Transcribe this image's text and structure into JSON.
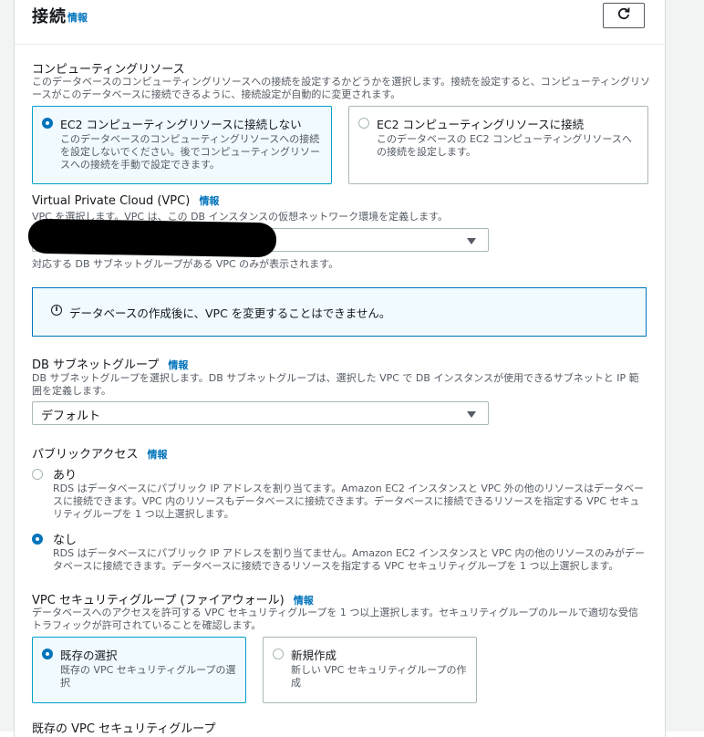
{
  "header": {
    "title": "接続",
    "info": "情報"
  },
  "compute": {
    "title": "コンピューティングリソース",
    "description": "このデータベースのコンピューティングリソースへの接続を設定するかどうかを選択します。接続を設定すると、コンピューティングリソースがこのデータベースに接続できるように、接続設定が自動的に変更されます。",
    "options": [
      {
        "label": "EC2 コンピューティングリソースに接続しない",
        "description": "このデータベースのコンピューティングリソースへの接続を設定しないでください。後でコンピューティングリソースへの接続を手動で設定できます。",
        "selected": true
      },
      {
        "label": "EC2 コンピューティングリソースに接続",
        "description": "このデータベースの EC2 コンピューティングリソースへの接続を設定します。",
        "selected": false
      }
    ]
  },
  "vpc": {
    "title": "Virtual Private Cloud (VPC)",
    "info": "情報",
    "description": "VPC を選択します。VPC は、この DB インスタンスの仮想ネットワーク環境を定義します。",
    "value": "",
    "hint": "対応する DB サブネットグループがある VPC のみが表示されます。"
  },
  "alert": {
    "text": "データベースの作成後に、VPC を変更することはできません。"
  },
  "subnet": {
    "title": "DB サブネットグループ",
    "info": "情報",
    "description": "DB サブネットグループを選択します。DB サブネットグループは、選択した VPC で DB インスタンスが使用できるサブネットと IP 範囲を定義します。",
    "value": "デフォルト"
  },
  "public_access": {
    "title": "パブリックアクセス",
    "info": "情報",
    "options": [
      {
        "label": "あり",
        "description": "RDS はデータベースにパブリック IP アドレスを割り当てます。Amazon EC2 インスタンスと VPC 外の他のリソースはデータベースに接続できます。VPC 内のリソースもデータベースに接続できます。データベースに接続できるリソースを指定する VPC セキュリティグループを 1 つ以上選択します。",
        "selected": false
      },
      {
        "label": "なし",
        "description": "RDS はデータベースにパブリック IP アドレスを割り当てません。Amazon EC2 インスタンスと VPC 内の他のリソースのみがデータベースに接続できます。データベースに接続できるリソースを指定する VPC セキュリティグループを 1 つ以上選択します。",
        "selected": true
      }
    ]
  },
  "security_group": {
    "title": "VPC セキュリティグループ (ファイアウォール)",
    "info": "情報",
    "description": "データベースへのアクセスを許可する VPC セキュリティグループを 1 つ以上選択します。セキュリティグループのルールで適切な受信トラフィックが許可されていることを確認します。",
    "options": [
      {
        "label": "既存の選択",
        "description": "既存の VPC セキュリティグループの選択",
        "selected": true
      },
      {
        "label": "新規作成",
        "description": "新しい VPC セキュリティグループの作成",
        "selected": false
      }
    ],
    "existing_label": "既存の VPC セキュリティグループ"
  }
}
